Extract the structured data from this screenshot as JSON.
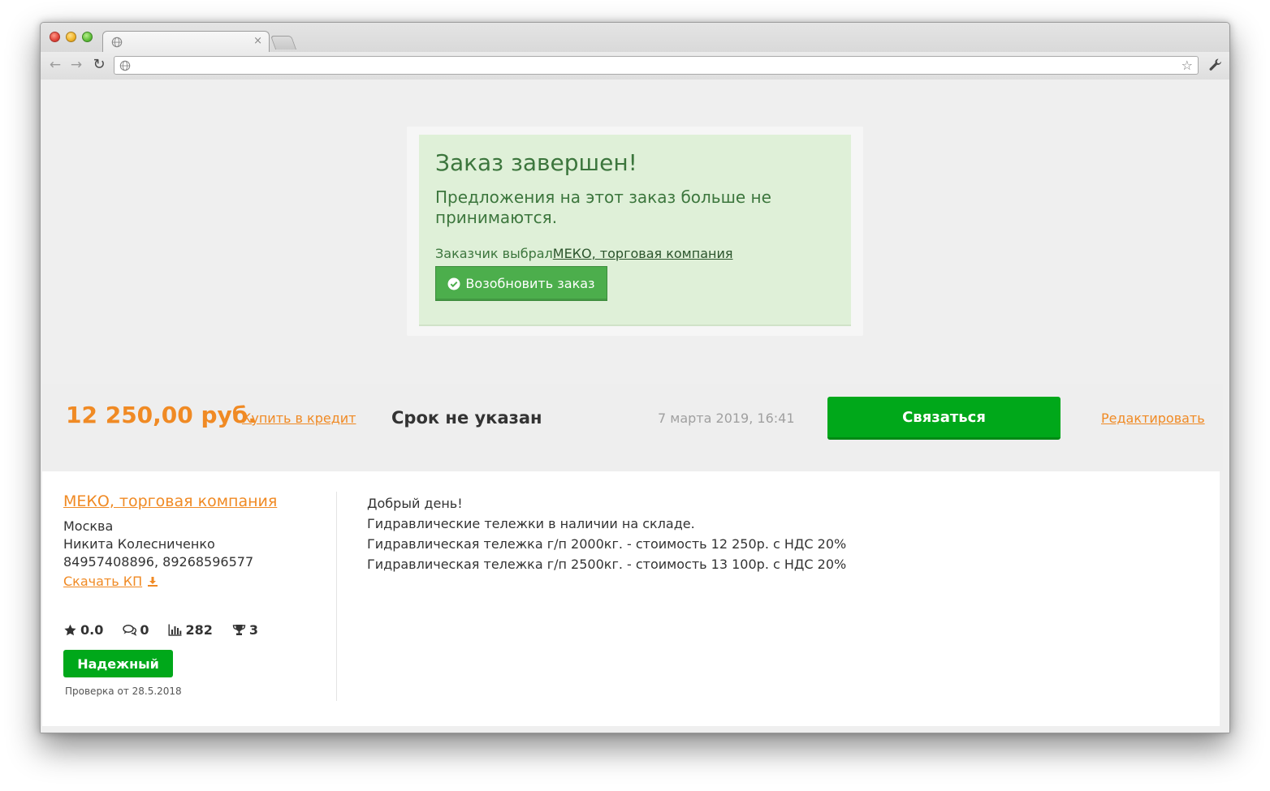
{
  "browser": {
    "tab_close": "×",
    "star": "☆"
  },
  "alert": {
    "title": "Заказ завершен!",
    "subtitle": "Предложения на этот заказ больше не принимаются.",
    "chosen_prefix": "Заказчик выбрал",
    "chosen_company": "МЕКО, торговая компания",
    "renew_button": "Возобновить заказ"
  },
  "offer_bar": {
    "price": "12 250,00 руб.",
    "credit_link": "Купить в кредит",
    "deadline": "Срок не указан",
    "date": "7 марта 2019, 16:41",
    "contact_button": "Связаться",
    "edit_link": "Редактировать"
  },
  "company": {
    "name": "МЕКО, торговая компания",
    "city": "Москва",
    "person": "Никита Колесниченко",
    "phones": "84957408896, 89268596577",
    "download_link": "Скачать КП"
  },
  "stats": {
    "rating": "0.0",
    "reviews": "0",
    "views": "282",
    "wins": "3"
  },
  "badge": {
    "label": "Надежный",
    "check_date": "Проверка от 28.5.2018"
  },
  "message": {
    "lines": [
      "Добрый день!",
      "Гидравлические тележки в наличии на складе.",
      "Гидравлическая тележка г/п 2000кг. - стоимость 12 250р. с НДС 20%",
      "Гидравлическая тележка г/п 2500кг. - стоимость 13 100р. с НДС 20%"
    ]
  },
  "colors": {
    "accent_orange": "#f08a24",
    "green_button": "#00a81a",
    "alert_bg": "#dff0d8",
    "alert_text": "#3c763d"
  }
}
